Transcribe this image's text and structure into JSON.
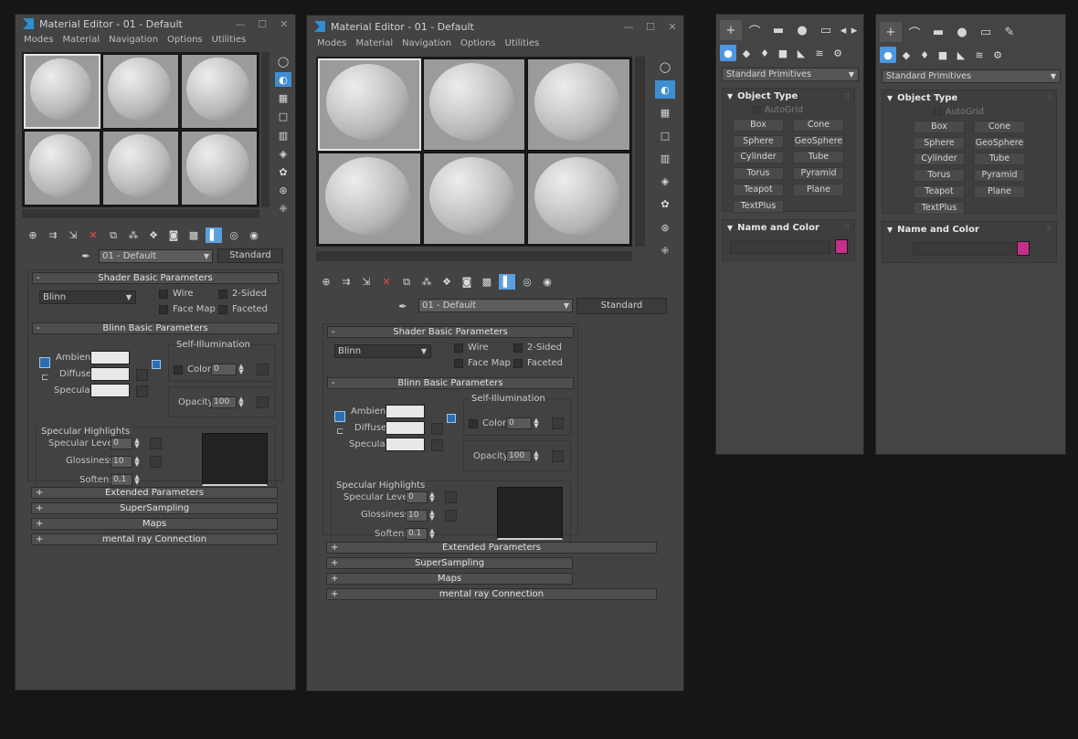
{
  "editor1": {
    "title": "Material Editor - 01 - Default",
    "controls": {
      "min": "—",
      "max": "☐",
      "close": "✕"
    },
    "menu": [
      "Modes",
      "Material",
      "Navigation",
      "Options",
      "Utilities"
    ],
    "material_name": "01 - Default",
    "material_type": "Standard",
    "shader": {
      "header": "Shader Basic Parameters",
      "selected": "Blinn",
      "wire": "Wire",
      "two_sided": "2-Sided",
      "face_map": "Face Map",
      "faceted": "Faceted"
    },
    "blinn": {
      "header": "Blinn Basic Parameters",
      "self_illum": "Self-Illumination",
      "color": "Color",
      "color_val": "0",
      "ambient": "Ambient:",
      "diffuse": "Diffuse:",
      "specular": "Specular:",
      "opacity": "Opacity:",
      "opacity_val": "100"
    },
    "spec": {
      "title": "Specular Highlights",
      "level": "Specular Level:",
      "level_val": "0",
      "gloss": "Glossiness:",
      "gloss_val": "10",
      "soften": "Soften:",
      "soften_val": "0,1"
    },
    "rollouts": [
      "Extended Parameters",
      "SuperSampling",
      "Maps",
      "mental ray Connection"
    ],
    "minus": "-",
    "plus": "+"
  },
  "editor2": {
    "title": "Material Editor - 01 - Default",
    "controls": {
      "min": "—",
      "max": "☐",
      "close": "✕"
    },
    "menu": [
      "Modes",
      "Material",
      "Navigation",
      "Options",
      "Utilities"
    ],
    "material_name": "01 - Default",
    "material_type": "Standard",
    "shader": {
      "header": "Shader Basic Parameters",
      "selected": "Blinn",
      "wire": "Wire",
      "two_sided": "2-Sided",
      "face_map": "Face Map",
      "faceted": "Faceted"
    },
    "blinn": {
      "header": "Blinn Basic Parameters",
      "self_illum": "Self-Illumination",
      "color": "Color",
      "color_val": "0",
      "ambient": "Ambient:",
      "diffuse": "Diffuse:",
      "specular": "Specular:",
      "opacity": "Opacity:",
      "opacity_val": "100"
    },
    "spec": {
      "title": "Specular Highlights",
      "level": "Specular Level:",
      "level_val": "0",
      "gloss": "Glossiness:",
      "gloss_val": "10",
      "soften": "Soften:",
      "soften_val": "0.1"
    },
    "rollouts": [
      "Extended Parameters",
      "SuperSampling",
      "Maps",
      "mental ray Connection"
    ],
    "minus": "-",
    "plus": "+"
  },
  "cmd1": {
    "tabs": [
      "+",
      "⌒",
      "▬",
      "●",
      "▭",
      "◂",
      "▸"
    ],
    "cats": [
      "●",
      "◆",
      "♦",
      "■",
      "◣",
      "≋",
      "⚙"
    ],
    "dropdown": "Standard Primitives",
    "object_type": "Object Type",
    "autogrid": "AutoGrid",
    "buttons": [
      "Box",
      "Cone",
      "Sphere",
      "GeoSphere",
      "Cylinder",
      "Tube",
      "Torus",
      "Pyramid",
      "Teapot",
      "Plane",
      "TextPlus"
    ],
    "name_color": "Name and Color",
    "swatch_color": "#c42f8a"
  },
  "cmd2": {
    "tabs": [
      "+",
      "⌒",
      "▬",
      "●",
      "▭",
      "✎"
    ],
    "cats": [
      "●",
      "◆",
      "♦",
      "■",
      "◣",
      "≋",
      "⚙"
    ],
    "dropdown": "Standard Primitives",
    "object_type": "Object Type",
    "autogrid": "AutoGrid",
    "buttons": [
      "Box",
      "Cone",
      "Sphere",
      "GeoSphere",
      "Cylinder",
      "Tube",
      "Torus",
      "Pyramid",
      "Teapot",
      "Plane",
      "TextPlus"
    ],
    "name_color": "Name and Color",
    "swatch_color": "#c42f8a"
  },
  "icons": {
    "sample_type": "sphere-icon",
    "backlight": "backlight-icon",
    "background": "checker-icon",
    "uv_tiling": "tiling-icon",
    "video_check": "video-color-icon",
    "make_preview": "preview-icon",
    "options": "options-icon",
    "select_by_material": "select-by-material-icon",
    "material_map_nav": "navigator-icon",
    "eyedropper": "eyedropper-icon"
  }
}
